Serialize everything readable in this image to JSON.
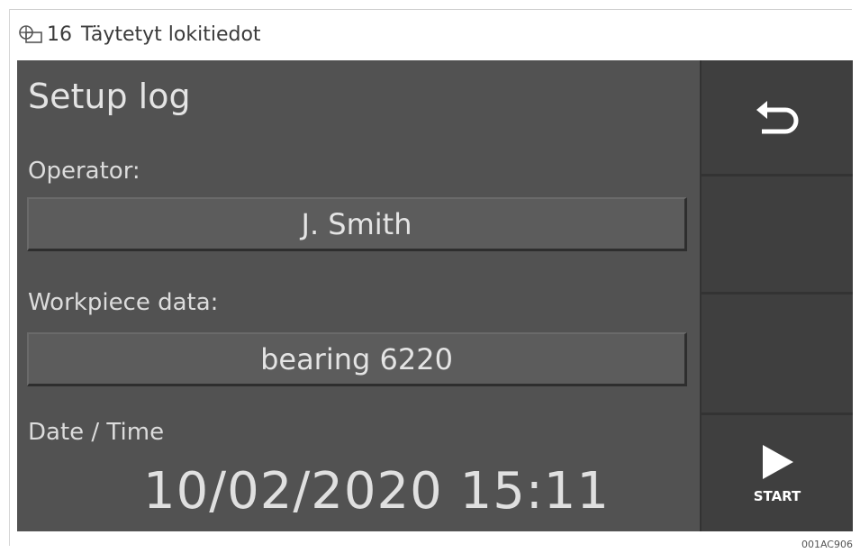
{
  "caption": {
    "number": "16",
    "title": "Täytetyt lokitiedot"
  },
  "screen": {
    "title": "Setup log",
    "operator": {
      "label": "Operator:",
      "value": "J. Smith"
    },
    "workpiece": {
      "label": "Workpiece data:",
      "value": "bearing 6220"
    },
    "datetime": {
      "label": "Date / Time",
      "value": "10/02/2020 15:11"
    }
  },
  "sidebar": {
    "back_icon": "return-arrow-icon",
    "start": {
      "icon": "play-icon",
      "label": "START"
    }
  },
  "colors": {
    "screen_bg": "#525252",
    "sidebar_bg": "#333333",
    "button_bg": "#3f3f3f",
    "text": "#e4e4e4"
  },
  "figure_code": "001AC906"
}
